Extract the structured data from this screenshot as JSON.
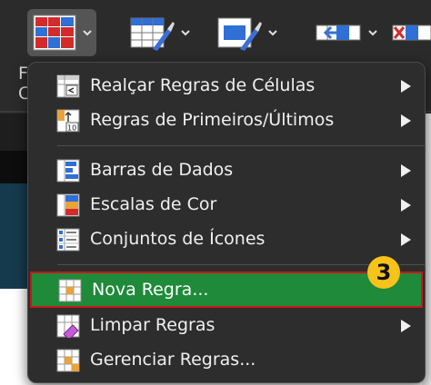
{
  "ribbon": {
    "buttons": [
      {
        "name": "conditional-formatting-button",
        "icon": "conditional-formatting-icon"
      },
      {
        "name": "format-as-table-button",
        "icon": "format-as-table-icon"
      },
      {
        "name": "cell-styles-button",
        "icon": "cell-styles-icon"
      },
      {
        "name": "insert-cells-button",
        "icon": "insert-cells-icon"
      },
      {
        "name": "delete-cells-button",
        "icon": "delete-cells-icon"
      }
    ],
    "partial_labels": [
      "F",
      "C"
    ]
  },
  "menu": {
    "items": [
      {
        "label": "Realçar Regras de Células",
        "icon": "highlight-cells-rules-icon",
        "submenu": true
      },
      {
        "label": "Regras de Primeiros/Últimos",
        "icon": "top-bottom-rules-icon",
        "submenu": true
      },
      {
        "label": "Barras de Dados",
        "icon": "data-bars-icon",
        "submenu": true
      },
      {
        "label": "Escalas de Cor",
        "icon": "color-scales-icon",
        "submenu": true
      },
      {
        "label": "Conjuntos de Ícones",
        "icon": "icon-sets-icon",
        "submenu": true
      },
      {
        "label": "Nova Regra...",
        "icon": "new-rule-icon",
        "submenu": false,
        "highlighted": true
      },
      {
        "label": "Limpar Regras",
        "icon": "clear-rules-icon",
        "submenu": true
      },
      {
        "label": "Gerenciar Regras...",
        "icon": "manage-rules-icon",
        "submenu": false
      }
    ]
  },
  "annotation": {
    "step_badge": "3"
  },
  "colors": {
    "highlight": "#1f8a3a",
    "highlight_border": "#c8171e",
    "badge": "#f7c21a",
    "menu_bg": "#2d2d2d"
  }
}
